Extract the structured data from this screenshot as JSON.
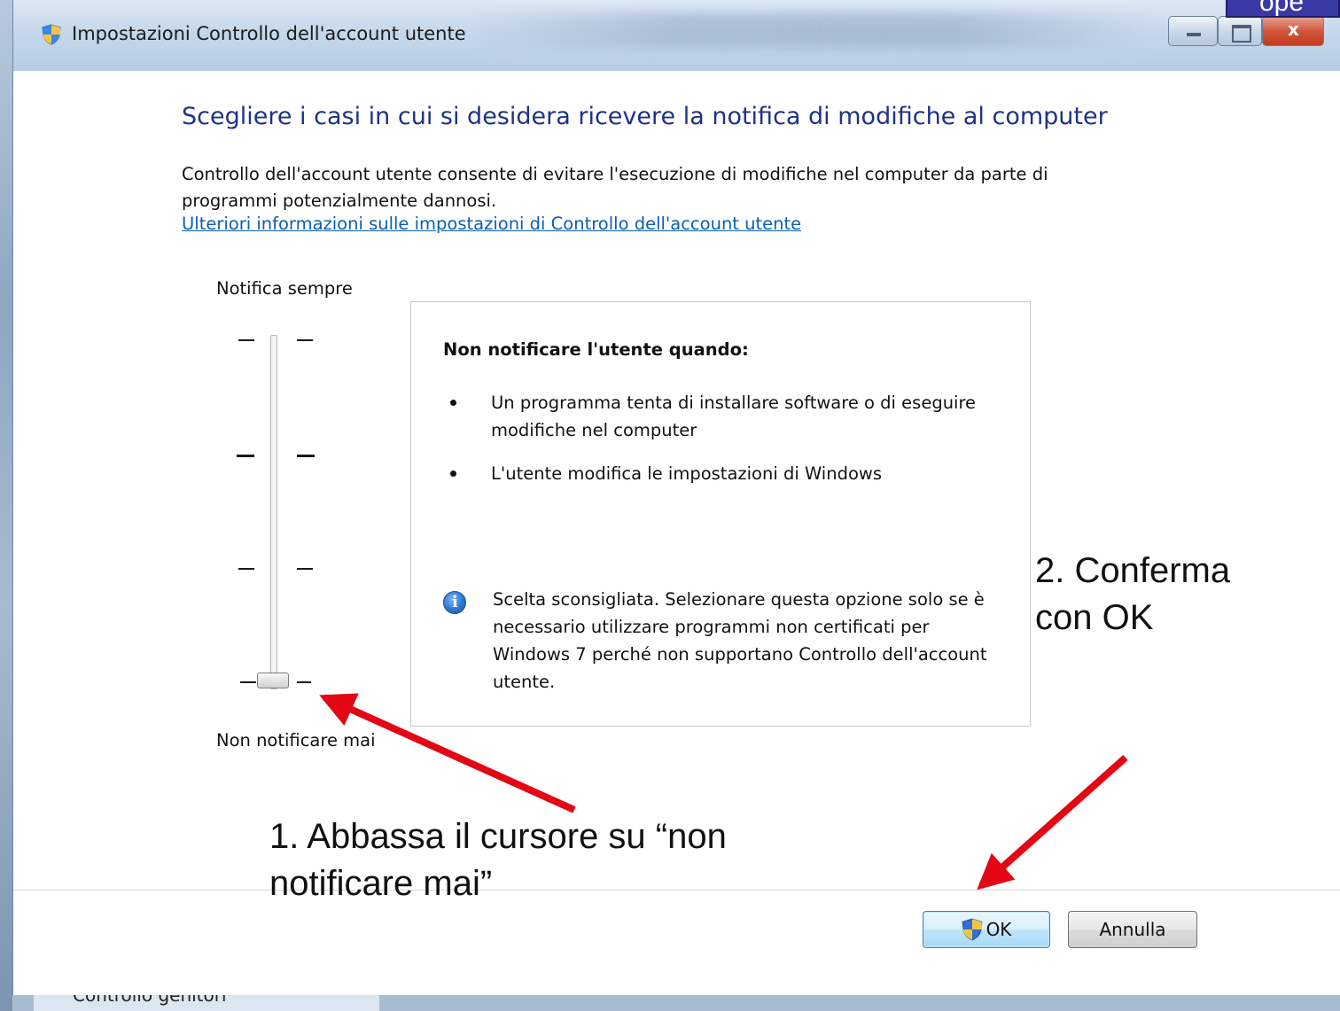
{
  "window": {
    "title": "Impostazioni Controllo dell'account utente",
    "corner_tag": "ope",
    "icons": {
      "title": "uac-shield-icon",
      "ok": "uac-shield-icon",
      "info": "info-icon"
    }
  },
  "main": {
    "heading": "Scegliere i casi in cui si desidera ricevere la notifica di modifiche al computer",
    "description": "Controllo dell'account utente consente di evitare l'esecuzione di modifiche nel computer da parte di programmi potenzialmente dannosi.",
    "link": "Ulteriori informazioni sulle impostazioni di Controllo dell'account utente"
  },
  "slider": {
    "label_top": "Notifica sempre",
    "label_bottom": "Non notificare mai",
    "levels": 4,
    "selected_level": 1
  },
  "info": {
    "title": "Non notificare l'utente quando:",
    "bullets": [
      "Un programma tenta di installare software o di eseguire modifiche nel computer",
      "L'utente modifica le impostazioni di Windows"
    ],
    "warning": "Scelta sconsigliata. Selezionare questa opzione solo se è necessario utilizzare programmi non certificati per Windows 7 perché non supportano Controllo dell'account utente."
  },
  "buttons": {
    "ok": "OK",
    "cancel": "Annulla"
  },
  "annotations": {
    "step1": "1. Abbassa il cursore su “non notificare mai”",
    "step2": "2. Conferma con OK",
    "arrow_color": "#e30613"
  },
  "taskbar": {
    "item": "Controllo genitori"
  }
}
